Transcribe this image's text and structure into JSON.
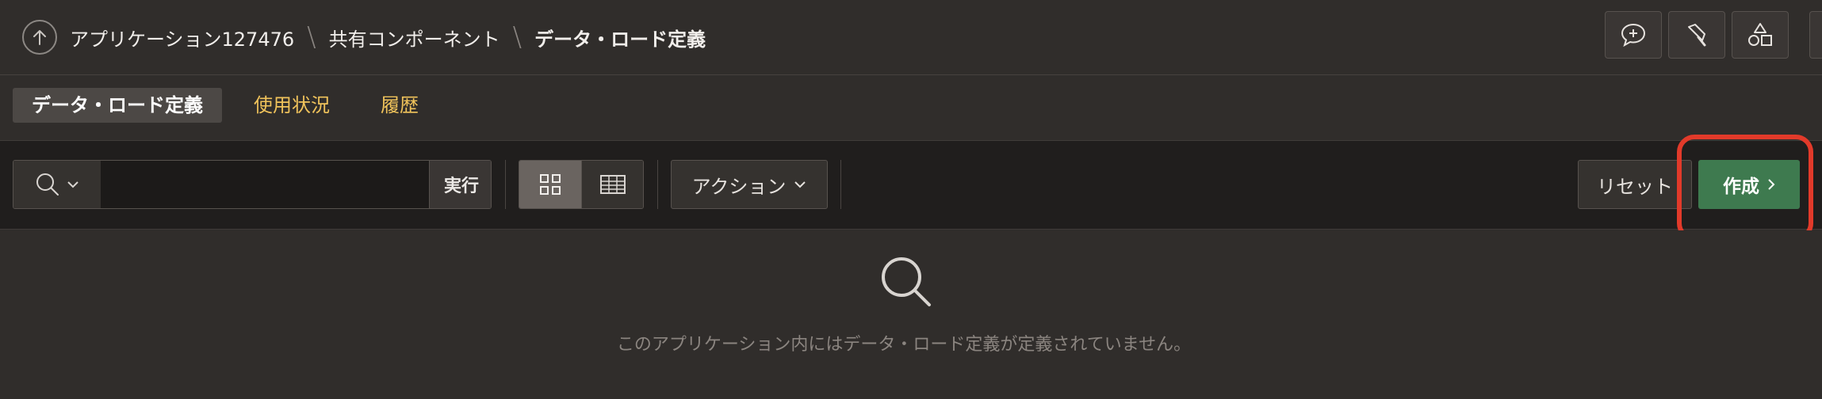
{
  "breadcrumb": {
    "items": [
      "アプリケーション127476",
      "共有コンポーネント",
      "データ・ロード定義"
    ]
  },
  "header_tools": {
    "icons": [
      "comment-add-icon",
      "flashlight-icon",
      "shapes-icon"
    ]
  },
  "tabs": [
    {
      "label": "データ・ロード定義",
      "active": true
    },
    {
      "label": "使用状況",
      "active": false
    },
    {
      "label": "履歴",
      "active": false
    }
  ],
  "toolbar": {
    "search_value": "",
    "go_label": "実行",
    "actions_label": "アクション",
    "reset_label": "リセット",
    "create_label": "作成"
  },
  "empty_state": {
    "message": "このアプリケーション内にはデータ・ロード定義が定義されていません。"
  },
  "colors": {
    "background": "#2f2c2a",
    "toolbar": "#201e1d",
    "link": "#f0c35b",
    "create_button": "#3e7a4f",
    "highlight": "#e23a2a"
  }
}
